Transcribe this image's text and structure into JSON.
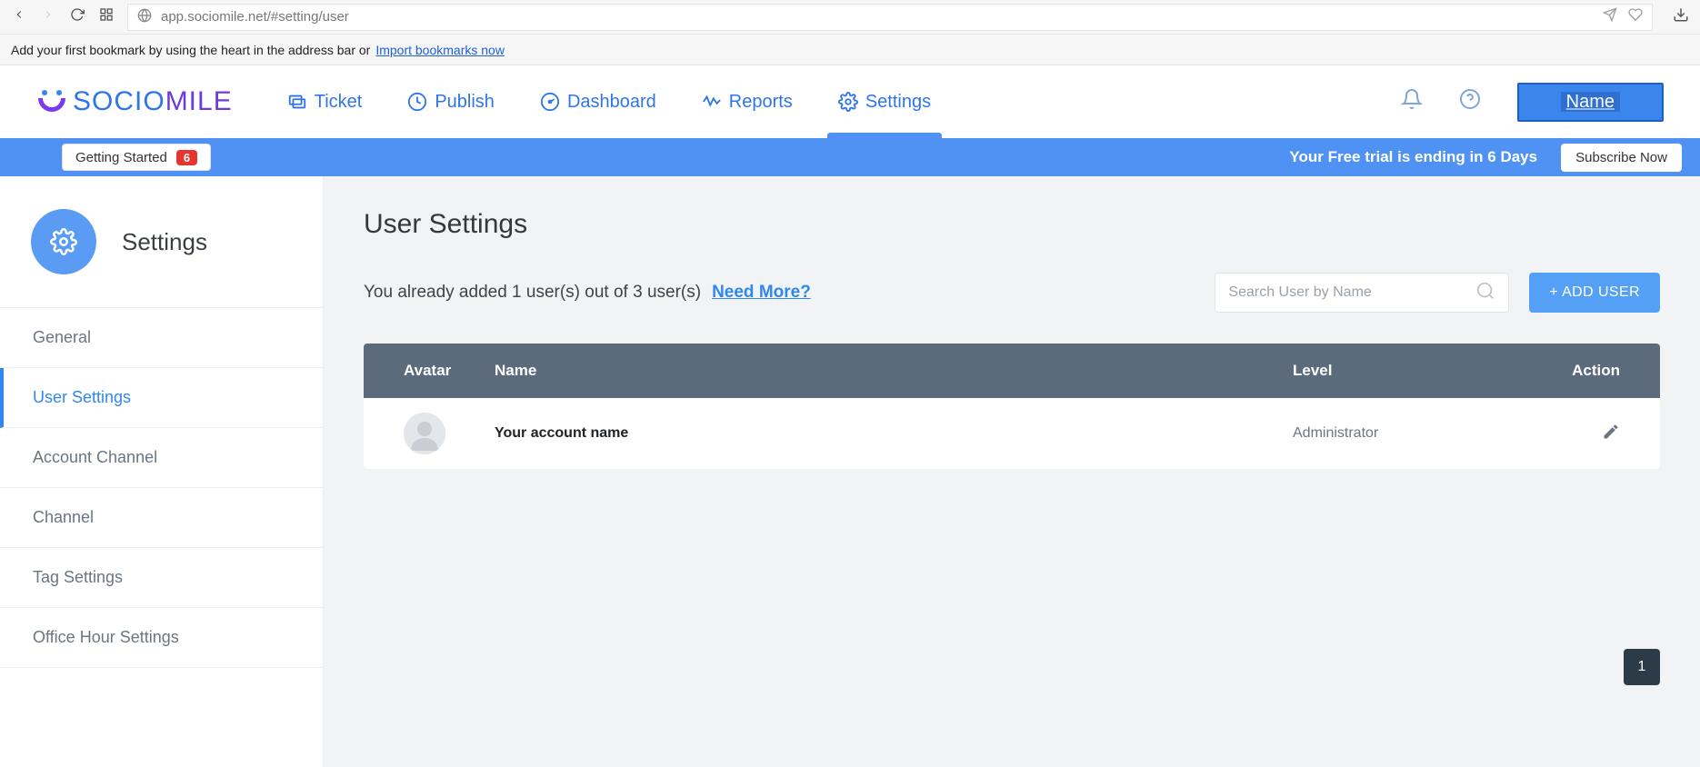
{
  "browser": {
    "url": "app.sociomile.net/#setting/user",
    "bookmark_hint": "Add your first bookmark by using the heart in the address bar or",
    "import_link": "Import bookmarks now"
  },
  "brand": {
    "p1": "SOCIO",
    "p2": "MILE"
  },
  "topnav": [
    {
      "label": "Ticket"
    },
    {
      "label": "Publish"
    },
    {
      "label": "Dashboard"
    },
    {
      "label": "Reports"
    },
    {
      "label": "Settings"
    }
  ],
  "user_chip": "Name",
  "trial": {
    "getting_started": "Getting Started",
    "count": "6",
    "message": "Your Free trial is ending in 6 Days",
    "subscribe": "Subscribe Now"
  },
  "sidebar": {
    "title": "Settings",
    "items": [
      {
        "label": "General"
      },
      {
        "label": "User Settings"
      },
      {
        "label": "Account Channel"
      },
      {
        "label": "Channel"
      },
      {
        "label": "Tag Settings"
      },
      {
        "label": "Office Hour Settings"
      }
    ]
  },
  "page": {
    "title": "User Settings",
    "info": "You already added 1 user(s) out of 3 user(s)",
    "need_more": "Need More?",
    "search_placeholder": "Search User by Name",
    "add_user": "+ ADD USER"
  },
  "table": {
    "headers": {
      "avatar": "Avatar",
      "name": "Name",
      "level": "Level",
      "action": "Action"
    },
    "rows": [
      {
        "name": "Your account name",
        "level": "Administrator"
      }
    ]
  },
  "pagination": {
    "current": "1"
  }
}
